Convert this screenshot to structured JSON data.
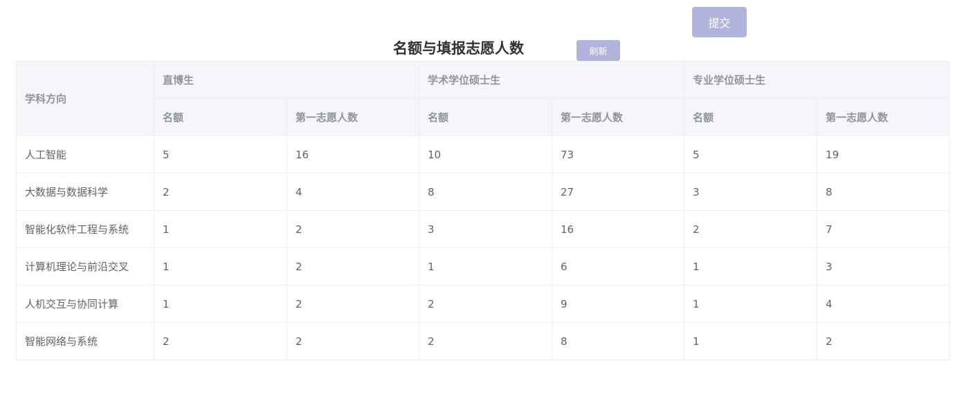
{
  "toolbar": {
    "submit_label": "提交",
    "refresh_label": "刷新"
  },
  "page_title": "名额与填报志愿人数",
  "table": {
    "subject_header": "学科方向",
    "groups": [
      {
        "label": "直博生",
        "quota_label": "名额",
        "applicants_label": "第一志愿人数"
      },
      {
        "label": "学术学位硕士生",
        "quota_label": "名额",
        "applicants_label": "第一志愿人数"
      },
      {
        "label": "专业学位硕士生",
        "quota_label": "名额",
        "applicants_label": "第一志愿人数"
      }
    ],
    "rows": [
      {
        "subject": "人工智能",
        "values": [
          "5",
          "16",
          "10",
          "73",
          "5",
          "19"
        ]
      },
      {
        "subject": "大数据与数据科学",
        "values": [
          "2",
          "4",
          "8",
          "27",
          "3",
          "8"
        ]
      },
      {
        "subject": "智能化软件工程与系统",
        "values": [
          "1",
          "2",
          "3",
          "16",
          "2",
          "7"
        ]
      },
      {
        "subject": "计算机理论与前沿交叉",
        "values": [
          "1",
          "2",
          "1",
          "6",
          "1",
          "3"
        ]
      },
      {
        "subject": "人机交互与协同计算",
        "values": [
          "1",
          "2",
          "2",
          "9",
          "1",
          "4"
        ]
      },
      {
        "subject": "智能网络与系统",
        "values": [
          "2",
          "2",
          "2",
          "8",
          "1",
          "2"
        ]
      }
    ]
  }
}
